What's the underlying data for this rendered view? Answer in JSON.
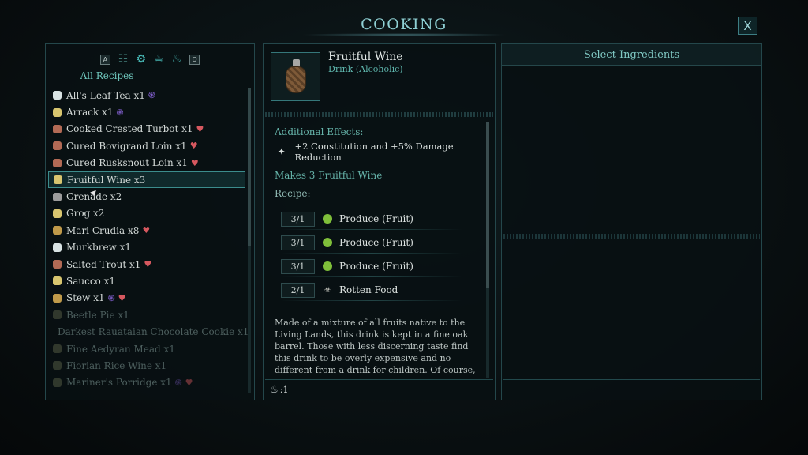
{
  "window": {
    "title": "COOKING",
    "close_label": "X"
  },
  "left": {
    "filter_keys": [
      "A",
      "D"
    ],
    "filters": [
      {
        "icon": "recipe-book-icon",
        "glyph": "☷",
        "active": true
      },
      {
        "icon": "meat-icon",
        "glyph": "⚙"
      },
      {
        "icon": "mug-icon",
        "glyph": "☕"
      },
      {
        "icon": "cloche-icon",
        "glyph": "♨"
      }
    ],
    "all_recipes_label": "All Recipes",
    "recipes": [
      {
        "name": "All's-Leaf Tea x1",
        "icon": "tea",
        "badges": [
          "purple"
        ],
        "state": "normal"
      },
      {
        "name": "Arrack x1",
        "icon": "drink",
        "badges": [
          "purple"
        ],
        "state": "normal"
      },
      {
        "name": "Cooked Crested Turbot x1",
        "icon": "meat",
        "badges": [
          "red"
        ],
        "state": "normal"
      },
      {
        "name": "Cured Bovigrand Loin x1",
        "icon": "meat",
        "badges": [
          "red"
        ],
        "state": "normal"
      },
      {
        "name": "Cured Rusksnout Loin x1",
        "icon": "meat",
        "badges": [
          "red"
        ],
        "state": "normal"
      },
      {
        "name": "Fruitful Wine x3",
        "icon": "drink",
        "badges": [],
        "state": "selected"
      },
      {
        "name": "Grenade x2",
        "icon": "mix",
        "badges": [],
        "state": "normal"
      },
      {
        "name": "Grog x2",
        "icon": "drink",
        "badges": [],
        "state": "normal"
      },
      {
        "name": "Mari Crudia x8",
        "icon": "stew",
        "badges": [
          "red"
        ],
        "state": "normal"
      },
      {
        "name": "Murkbrew x1",
        "icon": "tea",
        "badges": [],
        "state": "normal"
      },
      {
        "name": "Salted Trout x1",
        "icon": "meat",
        "badges": [
          "red"
        ],
        "state": "normal"
      },
      {
        "name": "Saucco x1",
        "icon": "drink",
        "badges": [],
        "state": "normal"
      },
      {
        "name": "Stew x1",
        "icon": "stew",
        "badges": [
          "purple",
          "red"
        ],
        "state": "normal"
      },
      {
        "name": "Beetle Pie x1",
        "icon": "locked",
        "badges": [],
        "state": "locked"
      },
      {
        "name": "Darkest Rauataian Chocolate Cookie x1",
        "icon": "locked",
        "badges": [],
        "state": "locked"
      },
      {
        "name": "Fine Aedyran Mead x1",
        "icon": "locked",
        "badges": [],
        "state": "locked"
      },
      {
        "name": "Fiorian Rice Wine x1",
        "icon": "locked",
        "badges": [],
        "state": "locked"
      },
      {
        "name": "Mariner's Porridge x1",
        "icon": "locked",
        "badges": [
          "purple",
          "red"
        ],
        "state": "locked"
      }
    ]
  },
  "detail": {
    "item_name": "Fruitful Wine",
    "item_type": "Drink (Alcoholic)",
    "additional_effects_label": "Additional Effects:",
    "effect_text": "+2 Constitution and +5% Damage Reduction",
    "makes_label": "Makes 3 Fruitful Wine",
    "recipe_label": "Recipe:",
    "ingredients": [
      {
        "count": "3/1",
        "name": "Produce (Fruit)",
        "icon": "fruit"
      },
      {
        "count": "3/1",
        "name": "Produce (Fruit)",
        "icon": "fruit"
      },
      {
        "count": "3/1",
        "name": "Produce (Fruit)",
        "icon": "fruit"
      },
      {
        "count": "2/1",
        "name": "Rotten Food",
        "icon": "rotten"
      }
    ],
    "description": "Made of a mixture of all fruits native to the Living Lands, this drink is kept in a fine oak barrel. Those with less discerning taste find this drink to be overly expensive and no different from a drink for children. Of course, the vintner",
    "footer_count": ":1"
  },
  "right": {
    "title": "Select Ingredients"
  }
}
